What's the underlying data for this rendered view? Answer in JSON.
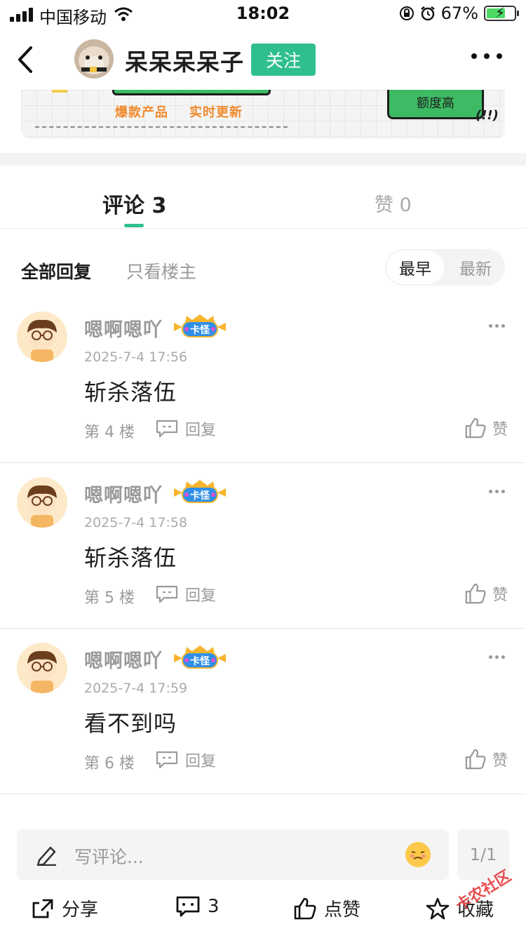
{
  "status_bar": {
    "carrier": "中国移动",
    "time": "18:02",
    "battery": "67%"
  },
  "nav": {
    "title": "呆呆呆呆子",
    "follow_label": "关注"
  },
  "banner": {
    "tag1": "爆款产品",
    "tag2": "实时更新",
    "button_text": "额度高",
    "exclaim": "(!!)"
  },
  "tabs": {
    "comments_label": "评论 3",
    "likes_label": "赞 0"
  },
  "filter": {
    "all_label": "全部回复",
    "op_only_label": "只看楼主",
    "sort_earliest": "最早",
    "sort_latest": "最新"
  },
  "comments": [
    {
      "name": "嗯啊嗯吖",
      "badge": "卡怪",
      "date": "2025-7-4 17:56",
      "text": "斩杀落伍",
      "floor": "第 4 楼",
      "reply_label": "回复",
      "like_label": "赞"
    },
    {
      "name": "嗯啊嗯吖",
      "badge": "卡怪",
      "date": "2025-7-4 17:58",
      "text": "斩杀落伍",
      "floor": "第 5 楼",
      "reply_label": "回复",
      "like_label": "赞"
    },
    {
      "name": "嗯啊嗯吖",
      "badge": "卡怪",
      "date": "2025-7-4 17:59",
      "text": "看不到吗",
      "floor": "第 6 楼",
      "reply_label": "回复",
      "like_label": "赞"
    }
  ],
  "input": {
    "placeholder": "写评论...",
    "page_indicator": "1/1"
  },
  "actions": {
    "share": "分享",
    "comment_count": "3",
    "like": "点赞",
    "collect": "收藏"
  },
  "watermark": "卡农社区",
  "colors": {
    "accent": "#2fbf8f"
  }
}
